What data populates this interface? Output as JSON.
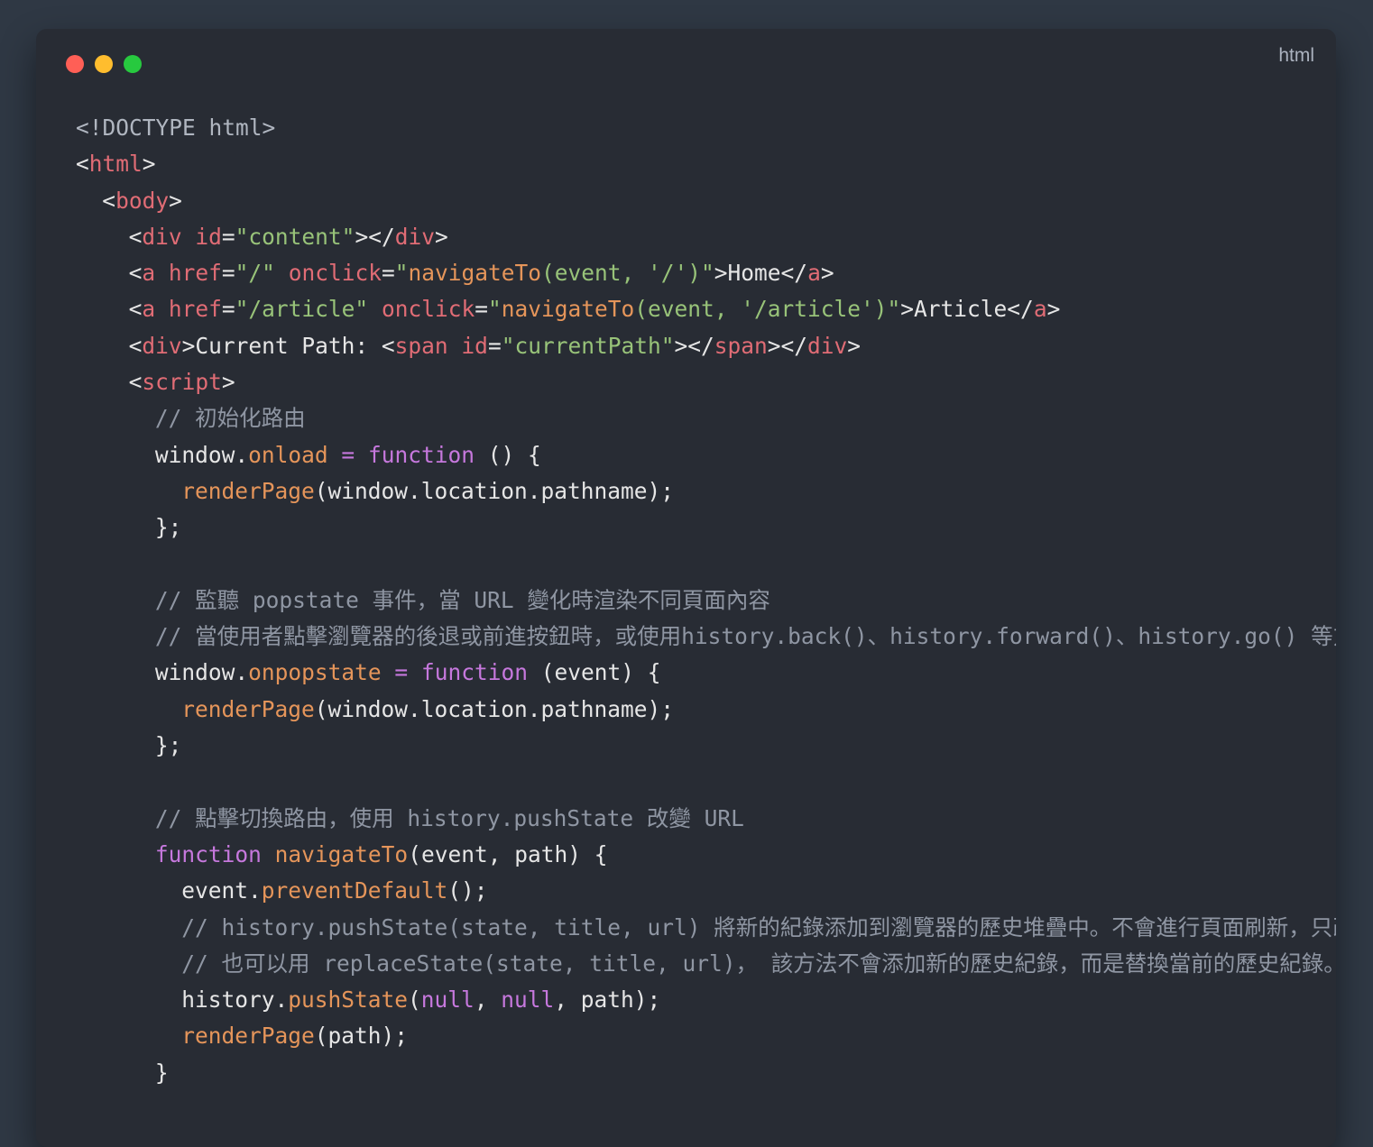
{
  "window": {
    "language_label": "html",
    "buttons": [
      {
        "name": "close",
        "color": "#ff5f56"
      },
      {
        "name": "minimize",
        "color": "#ffbd2e"
      },
      {
        "name": "zoom",
        "color": "#27c93f"
      }
    ]
  },
  "colors": {
    "background": "#2f3844",
    "panel": "#282c34",
    "tag": "#e06c75",
    "string": "#98c379",
    "function": "#e5955a",
    "keyword": "#c678dd",
    "comment": "#8f96a3",
    "text": "#e6e6e6"
  },
  "code_lines": [
    {
      "indent": 0,
      "tokens": [
        {
          "t": "<!DOCTYPE html>",
          "c": "doctype"
        }
      ]
    },
    {
      "indent": 0,
      "tokens": [
        {
          "t": "<",
          "c": "plain"
        },
        {
          "t": "html",
          "c": "tag"
        },
        {
          "t": ">",
          "c": "plain"
        }
      ]
    },
    {
      "indent": 1,
      "tokens": [
        {
          "t": "<",
          "c": "plain"
        },
        {
          "t": "body",
          "c": "tag"
        },
        {
          "t": ">",
          "c": "plain"
        }
      ]
    },
    {
      "indent": 2,
      "tokens": [
        {
          "t": "<",
          "c": "plain"
        },
        {
          "t": "div",
          "c": "tag"
        },
        {
          "t": " ",
          "c": "plain"
        },
        {
          "t": "id",
          "c": "attr"
        },
        {
          "t": "=",
          "c": "plain"
        },
        {
          "t": "\"content\"",
          "c": "str"
        },
        {
          "t": "></",
          "c": "plain"
        },
        {
          "t": "div",
          "c": "tag"
        },
        {
          "t": ">",
          "c": "plain"
        }
      ]
    },
    {
      "indent": 2,
      "tokens": [
        {
          "t": "<",
          "c": "plain"
        },
        {
          "t": "a",
          "c": "tag"
        },
        {
          "t": " ",
          "c": "plain"
        },
        {
          "t": "href",
          "c": "attr"
        },
        {
          "t": "=",
          "c": "plain"
        },
        {
          "t": "\"/\"",
          "c": "str"
        },
        {
          "t": " ",
          "c": "plain"
        },
        {
          "t": "onclick",
          "c": "attr"
        },
        {
          "t": "=",
          "c": "plain"
        },
        {
          "t": "\"",
          "c": "str"
        },
        {
          "t": "navigateTo",
          "c": "fn"
        },
        {
          "t": "(event, '/')",
          "c": "str"
        },
        {
          "t": "\"",
          "c": "str"
        },
        {
          "t": ">Home</",
          "c": "plain"
        },
        {
          "t": "a",
          "c": "tag"
        },
        {
          "t": ">",
          "c": "plain"
        }
      ]
    },
    {
      "indent": 2,
      "tokens": [
        {
          "t": "<",
          "c": "plain"
        },
        {
          "t": "a",
          "c": "tag"
        },
        {
          "t": " ",
          "c": "plain"
        },
        {
          "t": "href",
          "c": "attr"
        },
        {
          "t": "=",
          "c": "plain"
        },
        {
          "t": "\"/article\"",
          "c": "str"
        },
        {
          "t": " ",
          "c": "plain"
        },
        {
          "t": "onclick",
          "c": "attr"
        },
        {
          "t": "=",
          "c": "plain"
        },
        {
          "t": "\"",
          "c": "str"
        },
        {
          "t": "navigateTo",
          "c": "fn"
        },
        {
          "t": "(event, '/article')",
          "c": "str"
        },
        {
          "t": "\"",
          "c": "str"
        },
        {
          "t": ">Article</",
          "c": "plain"
        },
        {
          "t": "a",
          "c": "tag"
        },
        {
          "t": ">",
          "c": "plain"
        }
      ]
    },
    {
      "indent": 2,
      "tokens": [
        {
          "t": "<",
          "c": "plain"
        },
        {
          "t": "div",
          "c": "tag"
        },
        {
          "t": ">Current Path: <",
          "c": "plain"
        },
        {
          "t": "span",
          "c": "tag"
        },
        {
          "t": " ",
          "c": "plain"
        },
        {
          "t": "id",
          "c": "attr"
        },
        {
          "t": "=",
          "c": "plain"
        },
        {
          "t": "\"currentPath\"",
          "c": "str"
        },
        {
          "t": "></",
          "c": "plain"
        },
        {
          "t": "span",
          "c": "tag"
        },
        {
          "t": "></",
          "c": "plain"
        },
        {
          "t": "div",
          "c": "tag"
        },
        {
          "t": ">",
          "c": "plain"
        }
      ]
    },
    {
      "indent": 2,
      "tokens": [
        {
          "t": "<",
          "c": "plain"
        },
        {
          "t": "script",
          "c": "tag"
        },
        {
          "t": ">",
          "c": "plain"
        }
      ]
    },
    {
      "indent": 3,
      "tokens": [
        {
          "t": "// 初始化路由",
          "c": "cmt"
        }
      ]
    },
    {
      "indent": 3,
      "tokens": [
        {
          "t": "window.",
          "c": "plain"
        },
        {
          "t": "onload",
          "c": "fn"
        },
        {
          "t": " = ",
          "c": "kw"
        },
        {
          "t": "function",
          "c": "kw"
        },
        {
          "t": " () {",
          "c": "plain"
        }
      ]
    },
    {
      "indent": 4,
      "tokens": [
        {
          "t": "renderPage",
          "c": "fn"
        },
        {
          "t": "(window.location.pathname);",
          "c": "plain"
        }
      ]
    },
    {
      "indent": 3,
      "tokens": [
        {
          "t": "};",
          "c": "plain"
        }
      ]
    },
    {
      "indent": 0,
      "tokens": []
    },
    {
      "indent": 3,
      "tokens": [
        {
          "t": "// 監聽 popstate 事件，當 URL 變化時渲染不同頁面內容",
          "c": "cmt"
        }
      ]
    },
    {
      "indent": 3,
      "tokens": [
        {
          "t": "// 當使用者點擊瀏覽器的後退或前進按鈕時，或使用history.back()、history.forward()、history.go() 等方",
          "c": "cmt"
        }
      ]
    },
    {
      "indent": 3,
      "tokens": [
        {
          "t": "window.",
          "c": "plain"
        },
        {
          "t": "onpopstate",
          "c": "fn"
        },
        {
          "t": " = ",
          "c": "kw"
        },
        {
          "t": "function",
          "c": "kw"
        },
        {
          "t": " (event) {",
          "c": "plain"
        }
      ]
    },
    {
      "indent": 4,
      "tokens": [
        {
          "t": "renderPage",
          "c": "fn"
        },
        {
          "t": "(window.location.pathname);",
          "c": "plain"
        }
      ]
    },
    {
      "indent": 3,
      "tokens": [
        {
          "t": "};",
          "c": "plain"
        }
      ]
    },
    {
      "indent": 0,
      "tokens": []
    },
    {
      "indent": 3,
      "tokens": [
        {
          "t": "// 點擊切換路由，使用 history.pushState 改變 URL",
          "c": "cmt"
        }
      ]
    },
    {
      "indent": 3,
      "tokens": [
        {
          "t": "function",
          "c": "kw"
        },
        {
          "t": " ",
          "c": "plain"
        },
        {
          "t": "navigateTo",
          "c": "fn"
        },
        {
          "t": "(event, path) {",
          "c": "plain"
        }
      ]
    },
    {
      "indent": 4,
      "tokens": [
        {
          "t": "event.",
          "c": "plain"
        },
        {
          "t": "preventDefault",
          "c": "fn"
        },
        {
          "t": "();",
          "c": "plain"
        }
      ]
    },
    {
      "indent": 4,
      "tokens": [
        {
          "t": "// history.pushState(state, title, url) 將新的紀錄添加到瀏覽器的歷史堆疊中。不會進行頁面刷新，只改",
          "c": "cmt"
        }
      ]
    },
    {
      "indent": 4,
      "tokens": [
        {
          "t": "// 也可以用 replaceState(state, title, url)， 該方法不會添加新的歷史紀錄，而是替換當前的歷史紀錄。",
          "c": "cmt"
        }
      ]
    },
    {
      "indent": 4,
      "tokens": [
        {
          "t": "history.",
          "c": "plain"
        },
        {
          "t": "pushState",
          "c": "fn"
        },
        {
          "t": "(",
          "c": "plain"
        },
        {
          "t": "null",
          "c": "kw"
        },
        {
          "t": ", ",
          "c": "plain"
        },
        {
          "t": "null",
          "c": "kw"
        },
        {
          "t": ", path);",
          "c": "plain"
        }
      ]
    },
    {
      "indent": 4,
      "tokens": [
        {
          "t": "renderPage",
          "c": "fn"
        },
        {
          "t": "(path);",
          "c": "plain"
        }
      ]
    },
    {
      "indent": 3,
      "tokens": [
        {
          "t": "}",
          "c": "plain"
        }
      ]
    }
  ]
}
